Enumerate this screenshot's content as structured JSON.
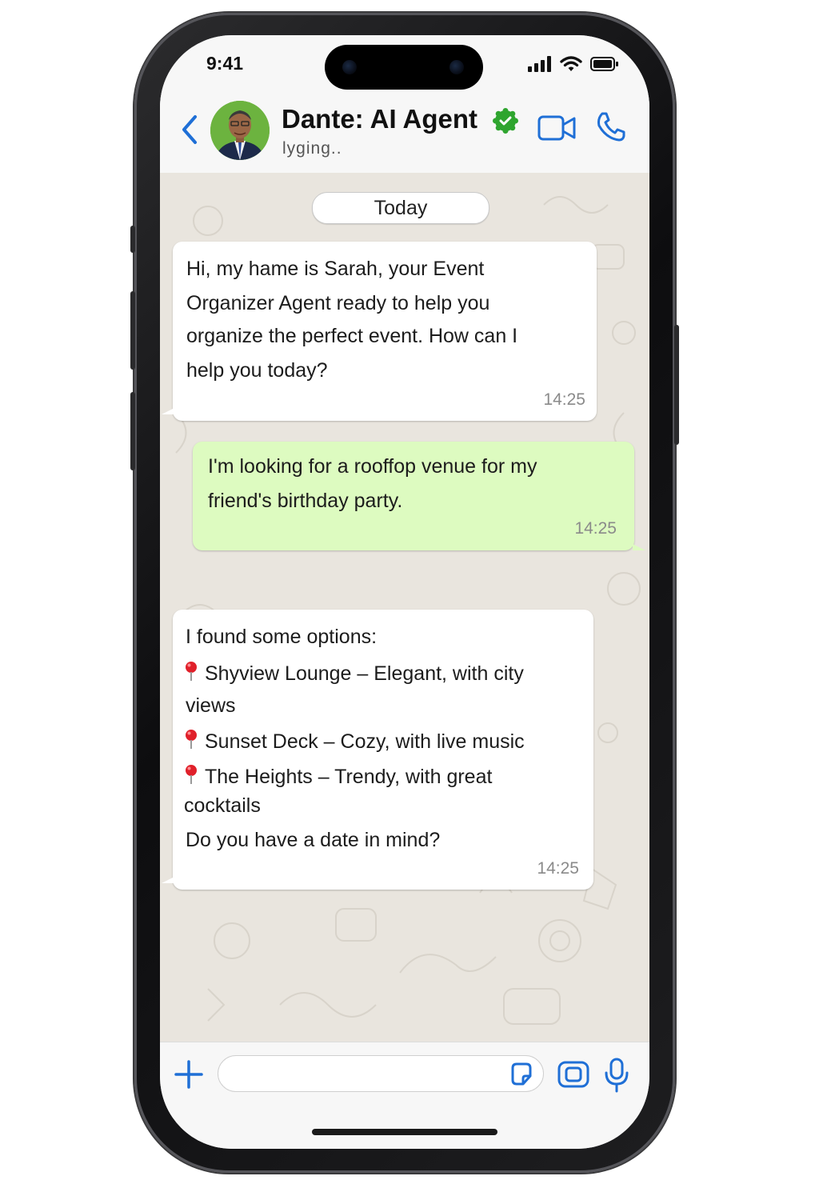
{
  "status_bar": {
    "time": "9:41",
    "signal_icon": "cellular-signal-icon",
    "wifi_icon": "wifi-icon",
    "battery_icon": "battery-icon"
  },
  "header": {
    "back_icon": "chevron-left-icon",
    "contact_name": "Dante: AI Agent",
    "verified_icon": "verified-badge-icon",
    "status": "lyging..",
    "video_icon": "video-camera-icon",
    "call_icon": "phone-icon"
  },
  "chat": {
    "date_label": "Today",
    "messages": [
      {
        "direction": "incoming",
        "lines": [
          "Hi, my hame is Sarah, your Event",
          "Organizer Agent ready to help you",
          "organize the perfect event. How can I",
          "help you today?"
        ],
        "time": "14:25"
      },
      {
        "direction": "outgoing",
        "lines": [
          "I'm looking for a rooffop venue for my",
          "friend's birthday party."
        ],
        "time": "14:25"
      },
      {
        "direction": "incoming",
        "intro": "I found some options:",
        "options": [
          {
            "first_line": "Shyview Lounge – Elegant, with city",
            "second_line": "views"
          },
          {
            "first_line": "Sunset Deck – Cozy, with live music",
            "second_line": ""
          },
          {
            "first_line": "The Heights – Trendy, with great",
            "second_line": "cocktails"
          }
        ],
        "pin_icon": "round-pushpin-icon",
        "question": "Do you have a date in mind?",
        "time": "14:25"
      }
    ]
  },
  "input_bar": {
    "plus_icon": "plus-icon",
    "placeholder": "",
    "sticker_icon": "sticker-icon",
    "camera_icon": "camera-icon",
    "mic_icon": "microphone-icon"
  },
  "colors": {
    "accent_blue": "#1f6fd6",
    "verified_green": "#2fa52f",
    "outgoing_bubble": "#ddfbc0",
    "incoming_bubble": "#ffffff",
    "chat_background": "#e9e5de"
  }
}
